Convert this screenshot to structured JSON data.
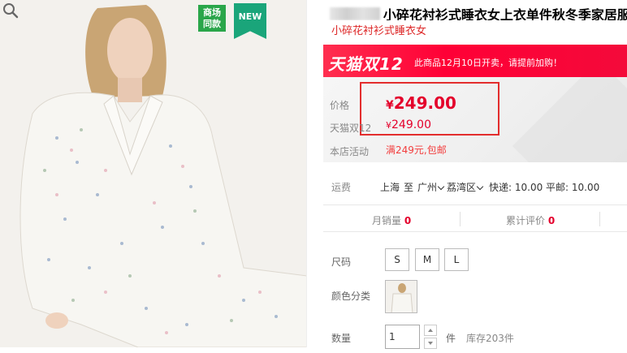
{
  "gallery": {
    "badge_mall": "商场\n同款",
    "badge_new": "NEW",
    "zoom_icon": "zoom-icon"
  },
  "product": {
    "title": "小碎花衬衫式睡衣女上衣单件秋冬季家居服上",
    "subtitle": "小碎花衬衫式睡衣女"
  },
  "promo": {
    "logo_text": "天猫双",
    "logo_num": "12",
    "text": "此商品12月10日开卖，请提前加购！"
  },
  "price": {
    "label": "价格",
    "currency": "¥",
    "value": "249.00",
    "tmall_label": "天猫双12",
    "tmall_value": "249.00",
    "store_label": "本店活动",
    "store_promo": "满249元,包邮",
    "accent_color": "#e4002b"
  },
  "shipping": {
    "label": "运费",
    "from": "上海",
    "to": "至",
    "city": "广州",
    "district": "荔湾区",
    "fee": "快递: 10.00 平邮: 10.00"
  },
  "stats": {
    "sales_label": "月销量",
    "sales_value": "0",
    "reviews_label": "累计评价",
    "reviews_value": "0"
  },
  "sku": {
    "size_label": "尺码",
    "sizes": [
      "S",
      "M",
      "L"
    ],
    "color_label": "颜色分类",
    "qty_label": "数量",
    "qty_value": "1",
    "qty_unit": "件",
    "stock": "库存203件"
  }
}
